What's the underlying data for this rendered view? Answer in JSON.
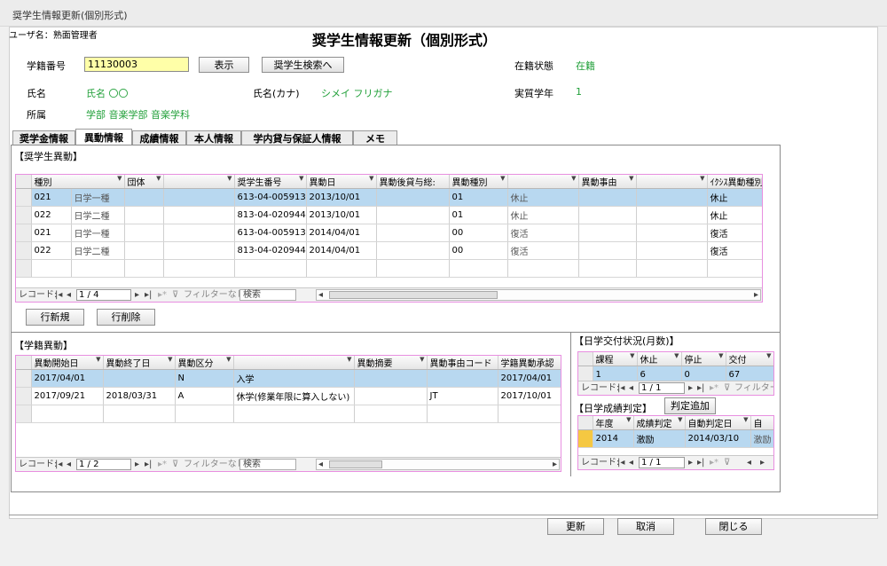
{
  "window": {
    "title": "奨学生情報更新(個別形式)"
  },
  "user": {
    "label": "ユーザ名：",
    "name": "熟面管理者"
  },
  "header": {
    "title": "奨学生情報更新（個別形式）"
  },
  "fields": {
    "student_no_label": "学籍番号",
    "student_no_value": "11130003",
    "show_button": "表示",
    "search_button": "奨学生検索へ",
    "enroll_label": "在籍状態",
    "enroll_value": "在籍",
    "name_label": "氏名",
    "name_value": "氏名 〇〇",
    "kana_label": "氏名(カナ)",
    "kana_value": "シメイ フリガナ",
    "grade_label": "実質学年",
    "grade_value": "1",
    "affil_label": "所属",
    "affil_value": "学部 音楽学部 音楽学科"
  },
  "tabs": [
    "奨学金情報",
    "異動情報",
    "成績情報",
    "本人情報",
    "学内貸与保証人情報",
    "メモ"
  ],
  "colors": {
    "accent_green": "#22a03a",
    "highlight_row": "#b8d8f0",
    "grid_border": "#e88fe0",
    "input_yellow": "#ffffa8"
  },
  "scholar_section": {
    "title": "【奨学生異動】",
    "headers": [
      "種別",
      "団体",
      "",
      "奨学生番号",
      "異動日",
      "異動後貸与総:",
      "異動種別",
      "",
      "異動事由",
      "",
      "ｲｸｼｽ異動種別"
    ],
    "rows": [
      [
        "021",
        "日学一種",
        "",
        "",
        "613-04-005913",
        "2013/10/01",
        "",
        "01",
        "休止",
        "",
        "",
        "休止"
      ],
      [
        "022",
        "日学二種",
        "",
        "",
        "813-04-020944",
        "2013/10/01",
        "",
        "01",
        "休止",
        "",
        "",
        "休止"
      ],
      [
        "021",
        "日学一種",
        "",
        "",
        "613-04-005913",
        "2014/04/01",
        "",
        "00",
        "復活",
        "",
        "",
        "復活"
      ],
      [
        "022",
        "日学二種",
        "",
        "",
        "813-04-020944",
        "2014/04/01",
        "",
        "00",
        "復活",
        "",
        "",
        "復活"
      ]
    ],
    "nav": {
      "record_label": "レコード:",
      "current": "1 / 4",
      "filter": "フィルターなし",
      "search": "検索"
    },
    "new_row_button": "行新規",
    "delete_row_button": "行削除"
  },
  "enroll_section": {
    "title": "【学籍異動】",
    "headers": [
      "異動開始日",
      "異動終了日",
      "異動区分",
      "",
      "異動摘要",
      "異動事由コード",
      "学籍異動承認"
    ],
    "rows": [
      [
        "2017/04/01",
        "",
        "N",
        "入学",
        "",
        "",
        "2017/04/01"
      ],
      [
        "2017/09/21",
        "2018/03/31",
        "A",
        "休学(修業年限に算入しない)",
        "",
        "JT",
        "2017/10/01"
      ]
    ],
    "nav": {
      "record_label": "レコード:",
      "current": "1 / 2",
      "filter": "フィルターなし",
      "search": "検索"
    }
  },
  "payment_section": {
    "title": "【日学交付状況(月数)】",
    "headers": [
      "課程",
      "休止",
      "停止",
      "交付"
    ],
    "rows": [
      [
        "1",
        "6",
        "0",
        "67"
      ]
    ],
    "nav": {
      "record_label": "レコード:",
      "current": "1 / 1",
      "filter": "フィルター"
    }
  },
  "grade_section": {
    "title": "【日学成績判定】",
    "add_button": "判定追加",
    "headers": [
      "年度",
      "成績判定",
      "自動判定日",
      "自"
    ],
    "rows": [
      [
        "2014",
        "激励",
        "2014/03/10",
        "激励"
      ]
    ],
    "nav": {
      "record_label": "レコード:",
      "current": "1 / 1"
    }
  },
  "footer": {
    "update_button": "更新",
    "cancel_button": "取消",
    "close_button": "閉じる"
  }
}
